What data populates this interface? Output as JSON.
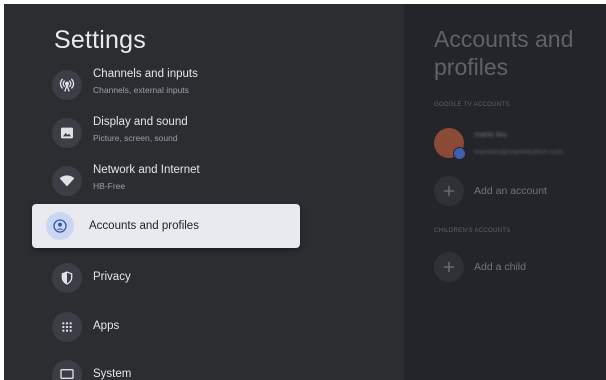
{
  "settings": {
    "title": "Settings",
    "items": [
      {
        "label": "Channels and inputs",
        "sub": "Channels, external inputs",
        "icon": "antenna-icon"
      },
      {
        "label": "Display and sound",
        "sub": "Picture, screen, sound",
        "icon": "display-icon"
      },
      {
        "label": "Network and Internet",
        "sub": "HB-Free",
        "icon": "wifi-icon"
      },
      {
        "label": "Accounts and profiles",
        "icon": "account-icon",
        "selected": true
      },
      {
        "label": "Privacy",
        "icon": "shield-icon"
      },
      {
        "label": "Apps",
        "icon": "apps-grid-icon"
      },
      {
        "label": "System",
        "icon": "monitor-icon"
      }
    ]
  },
  "detail": {
    "title": "Accounts and profiles",
    "google_tv_section": "GOOGLE TV ACCOUNTS",
    "account_name": "marie leu",
    "account_email": "marieleu@marieleutech.com",
    "add_account": "Add an account",
    "children_section": "CHILDREN'S ACCOUNTS",
    "add_child": "Add a child"
  },
  "colors": {
    "background": "#2b2d31",
    "panel": "#23252a",
    "selected_bg": "#e8eaef",
    "selected_icon_bg": "#c9d7f2"
  }
}
